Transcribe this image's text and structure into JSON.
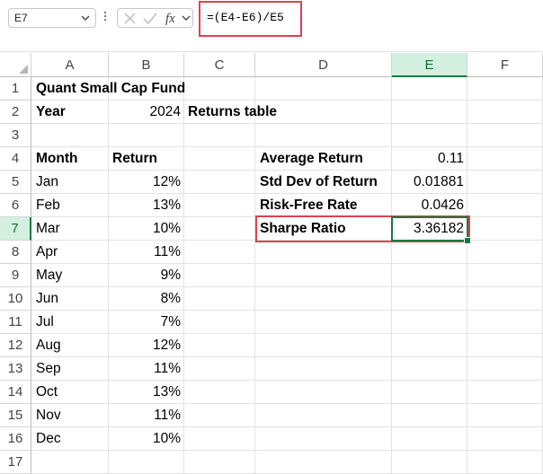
{
  "formula_bar": {
    "name_box": "E7",
    "formula": "=(E4-E6)/E5",
    "cancel_icon": "close-icon",
    "enter_icon": "checkmark-icon",
    "function_icon": "fx-icon"
  },
  "columns": [
    "A",
    "B",
    "C",
    "D",
    "E",
    "F"
  ],
  "rows": [
    "1",
    "2",
    "3",
    "4",
    "5",
    "6",
    "7",
    "8",
    "9",
    "10",
    "11",
    "12",
    "13",
    "14",
    "15",
    "16",
    "17"
  ],
  "cells": {
    "A1": "Quant Small Cap Fund",
    "A2": "Year",
    "B2": "2024",
    "C2": "Returns table",
    "A4": "Month",
    "B4": "Return",
    "D4": "Average Return",
    "E4": "0.11",
    "D5": "Std Dev of Return",
    "E5": "0.01881",
    "D6": "Risk-Free Rate",
    "E6": "0.0426",
    "D7": "Sharpe Ratio",
    "E7": "3.36182"
  },
  "monthly_returns": [
    {
      "month": "Jan",
      "return": "12%"
    },
    {
      "month": "Feb",
      "return": "13%"
    },
    {
      "month": "Mar",
      "return": "10%"
    },
    {
      "month": "Apr",
      "return": "11%"
    },
    {
      "month": "May",
      "return": "9%"
    },
    {
      "month": "Jun",
      "return": "8%"
    },
    {
      "month": "Jul",
      "return": "7%"
    },
    {
      "month": "Aug",
      "return": "12%"
    },
    {
      "month": "Sep",
      "return": "11%"
    },
    {
      "month": "Oct",
      "return": "13%"
    },
    {
      "month": "Nov",
      "return": "11%"
    },
    {
      "month": "Dec",
      "return": "10%"
    }
  ],
  "colors": {
    "selection": "#107c41",
    "header_selected_bg": "#d3f0e0",
    "highlight_red": "#e0414f"
  }
}
